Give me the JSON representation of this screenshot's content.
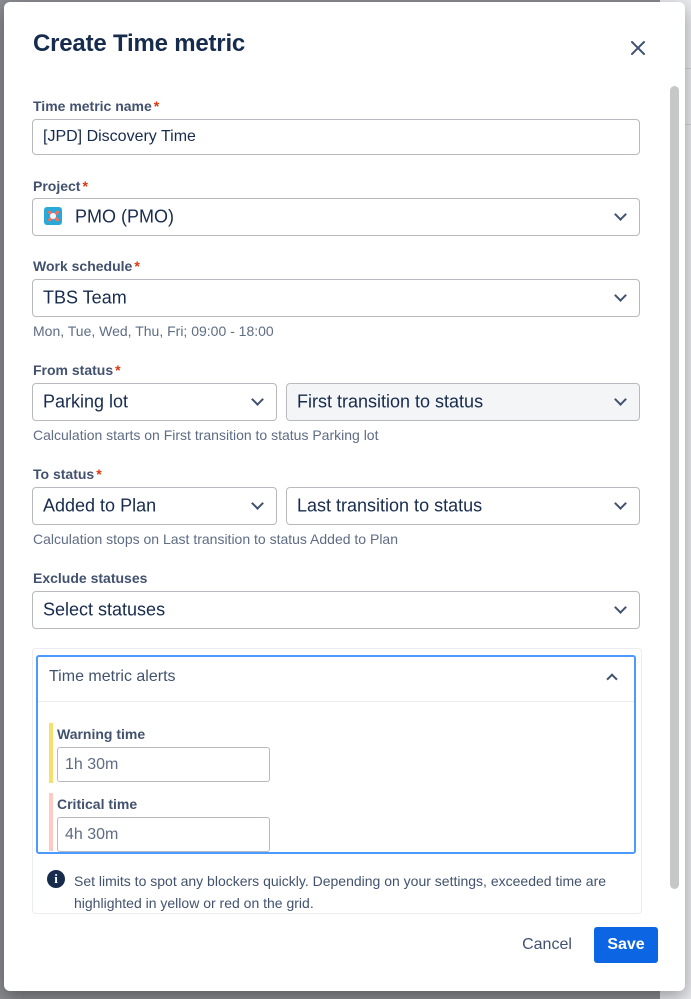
{
  "dialog": {
    "title": "Create Time metric"
  },
  "name": {
    "label": "Time metric name",
    "required": "*",
    "value": "[JPD] Discovery Time"
  },
  "project": {
    "label": "Project",
    "required": "*",
    "value": "PMO (PMO)"
  },
  "schedule": {
    "label": "Work schedule",
    "required": "*",
    "value": "TBS Team",
    "hint": "Mon, Tue, Wed, Thu, Fri; 09:00 - 18:00"
  },
  "from": {
    "label": "From status",
    "required": "*",
    "status": "Parking lot",
    "transition": "First transition to status",
    "hint": "Calculation starts on First transition to status Parking lot"
  },
  "to": {
    "label": "To status",
    "required": "*",
    "status": "Added to Plan",
    "transition": "Last transition to status",
    "hint": "Calculation stops on Last transition to status Added to Plan"
  },
  "exclude": {
    "label": "Exclude statuses",
    "placeholder": "Select statuses"
  },
  "alerts": {
    "title": "Time metric alerts",
    "warning": {
      "label": "Warning time",
      "value": "1h 30m",
      "color": "#f5e06b"
    },
    "critical": {
      "label": "Critical time",
      "value": "4h 30m",
      "color": "#ffc9c4"
    }
  },
  "info": {
    "text": "Set limits to spot any blockers quickly. Depending on your settings, exceeded time are highlighted in yellow or red on the grid."
  },
  "footer": {
    "cancel": "Cancel",
    "save": "Save"
  },
  "colors": {
    "primary": "#0c66e4",
    "focus": "#4c9aff",
    "required": "#de350b"
  }
}
